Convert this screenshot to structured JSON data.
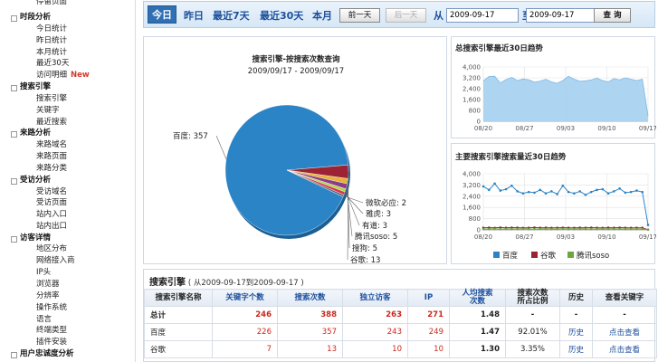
{
  "sidebar": {
    "items": [
      {
        "label": "停留页面",
        "type": "sub",
        "top": -3
      },
      {
        "label": "时段分析",
        "type": "cat",
        "top": 14
      },
      {
        "label": "今日统计",
        "type": "sub",
        "top": 27
      },
      {
        "label": "昨日统计",
        "type": "sub",
        "top": 40
      },
      {
        "label": "本月统计",
        "type": "sub",
        "top": 53
      },
      {
        "label": "最近30天",
        "type": "sub",
        "top": 65
      },
      {
        "label": "访问明细",
        "type": "sub",
        "top": 78,
        "badge": "New"
      },
      {
        "label": "搜索引擎",
        "type": "cat",
        "top": 91
      },
      {
        "label": "搜索引擎",
        "type": "sub",
        "top": 104
      },
      {
        "label": "关键字",
        "type": "sub",
        "top": 117
      },
      {
        "label": "最近搜索",
        "type": "sub",
        "top": 130
      },
      {
        "label": "来路分析",
        "type": "cat",
        "top": 142
      },
      {
        "label": "来路域名",
        "type": "sub",
        "top": 155
      },
      {
        "label": "来路页面",
        "type": "sub",
        "top": 168
      },
      {
        "label": "来路分类",
        "type": "sub",
        "top": 181
      },
      {
        "label": "受访分析",
        "type": "cat",
        "top": 194
      },
      {
        "label": "受访域名",
        "type": "sub",
        "top": 207
      },
      {
        "label": "受访页面",
        "type": "sub",
        "top": 219
      },
      {
        "label": "站内入口",
        "type": "sub",
        "top": 232
      },
      {
        "label": "站内出口",
        "type": "sub",
        "top": 245
      },
      {
        "label": "访客详情",
        "type": "cat",
        "top": 258
      },
      {
        "label": "地区分布",
        "type": "sub",
        "top": 270
      },
      {
        "label": "网络接入商",
        "type": "sub",
        "top": 283
      },
      {
        "label": "IP头",
        "type": "sub",
        "top": 296
      },
      {
        "label": "浏览器",
        "type": "sub",
        "top": 309
      },
      {
        "label": "分辨率",
        "type": "sub",
        "top": 322
      },
      {
        "label": "操作系统",
        "type": "sub",
        "top": 335
      },
      {
        "label": "语言",
        "type": "sub",
        "top": 348
      },
      {
        "label": "终端类型",
        "type": "sub",
        "top": 360
      },
      {
        "label": "插件安装",
        "type": "sub",
        "top": 373
      },
      {
        "label": "用户忠诚度分析",
        "type": "cat",
        "top": 386
      }
    ]
  },
  "toolbar": {
    "today": "今日",
    "yesterday": "昨日",
    "last7": "最近7天",
    "last30": "最近30天",
    "month": "本月",
    "prev_day": "前一天",
    "next_day": "后一天",
    "from_label": "从",
    "to_label": "至",
    "query": "查 询",
    "from_date": "2009-09-17",
    "to_date": "2009-09-17"
  },
  "pie": {
    "title": "搜索引擎-按搜索次数查询",
    "subtitle": "2009/09/17 - 2009/09/17"
  },
  "trend1": {
    "title": "总搜索引擎最近30日趋势"
  },
  "trend2": {
    "title": "主要搜索引擎搜索量近30日趋势"
  },
  "chart_data": [
    {
      "type": "pie",
      "title": "搜索引擎-按搜索次数查询",
      "subtitle": "2009/09/17 - 2009/09/17",
      "labels": [
        "百度",
        "谷歌",
        "搜狗",
        "腾讯soso",
        "有道",
        "雅虎",
        "微软必应"
      ],
      "values": [
        357,
        13,
        5,
        5,
        3,
        3,
        2
      ],
      "colors": [
        "#2b84c6",
        "#9b2333",
        "#e8b23a",
        "#8d3c8a",
        "#b5d64a",
        "#d8354b",
        "#5f6b7d"
      ]
    },
    {
      "type": "area",
      "title": "总搜索引擎最近30日趋势",
      "x_ticks": [
        "08/20",
        "08/27",
        "09/03",
        "09/10",
        "09/17"
      ],
      "y_ticks": [
        0,
        800,
        1600,
        2400,
        3200,
        4000
      ],
      "ylim": [
        0,
        4000
      ],
      "values": [
        2980,
        3300,
        3320,
        2820,
        3080,
        3240,
        3000,
        3120,
        3060,
        2880,
        2960,
        3100,
        2900,
        2800,
        3000,
        3320,
        3100,
        2950,
        2980,
        3050,
        3180,
        3000,
        2900,
        3150,
        3050,
        3200,
        3100,
        3000,
        3100,
        400
      ]
    },
    {
      "type": "line",
      "title": "主要搜索引擎搜索量近30日趋势",
      "x_ticks": [
        "08/20",
        "08/27",
        "09/03",
        "09/10",
        "09/17"
      ],
      "y_ticks": [
        0,
        800,
        1600,
        2400,
        3200,
        4000
      ],
      "ylim": [
        0,
        4000
      ],
      "series": [
        {
          "name": "百度",
          "color": "#2b84c6",
          "values": [
            3100,
            2850,
            3300,
            2800,
            2900,
            3150,
            2750,
            2600,
            2700,
            2650,
            2850,
            2600,
            2750,
            2550,
            3150,
            2700,
            2600,
            2750,
            2500,
            2700,
            2850,
            2900,
            2600,
            2750,
            2950,
            2650,
            2700,
            2800,
            2700,
            350
          ]
        },
        {
          "name": "谷歌",
          "color": "#9b2333",
          "values": [
            150,
            160,
            140,
            170,
            150,
            160,
            155,
            145,
            150,
            165,
            150,
            155,
            140,
            150,
            160,
            150,
            145,
            155,
            150,
            160,
            150,
            145,
            155,
            150,
            160,
            150,
            145,
            150,
            150,
            15
          ]
        },
        {
          "name": "腾讯soso",
          "color": "#6aa83c",
          "values": [
            60,
            55,
            70,
            60,
            65,
            55,
            60,
            70,
            60,
            55,
            65,
            60,
            55,
            60,
            70,
            60,
            55,
            65,
            60,
            55,
            60,
            65,
            55,
            60,
            65,
            60,
            55,
            60,
            60,
            8
          ]
        }
      ]
    }
  ],
  "table": {
    "title": "搜索引擎",
    "range": "( 从2009-09-17到2009-09-17 )",
    "headers": [
      "搜索引擎名称",
      "关键字个数",
      "搜索次数",
      "独立访客",
      "IP",
      "人均搜索\n次数",
      "搜索次数\n所占比例",
      "历史",
      "查看关键字"
    ],
    "rows": [
      {
        "name": "总计",
        "keywords": "246",
        "searches": "388",
        "visitors": "263",
        "ip": "271",
        "avg": "1.48",
        "ratio": "-",
        "history": "-",
        "view": "-",
        "total": true
      },
      {
        "name": "百度",
        "keywords": "226",
        "searches": "357",
        "visitors": "243",
        "ip": "249",
        "avg": "1.47",
        "ratio": "92.01%",
        "history": "历史",
        "view": "点击查看"
      },
      {
        "name": "谷歌",
        "keywords": "7",
        "searches": "13",
        "visitors": "10",
        "ip": "10",
        "avg": "1.30",
        "ratio": "3.35%",
        "history": "历史",
        "view": "点击查看"
      }
    ]
  }
}
